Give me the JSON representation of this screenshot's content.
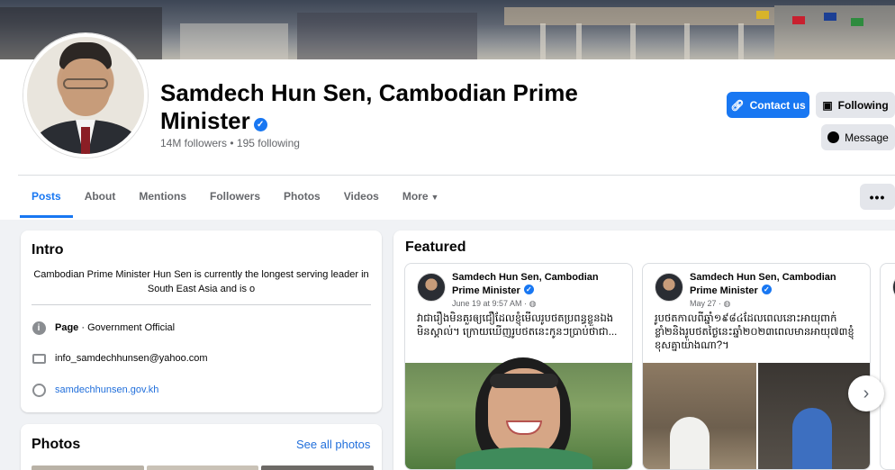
{
  "profile": {
    "name": "Samdech Hun Sen, Cambodian Prime Minister",
    "counts": "14M followers • 195 following"
  },
  "actions": {
    "contact": "Contact us",
    "following": "Following",
    "message": "Message",
    "more_dots": "•••"
  },
  "tabs": [
    {
      "label": "Posts",
      "active": true
    },
    {
      "label": "About"
    },
    {
      "label": "Mentions"
    },
    {
      "label": "Followers"
    },
    {
      "label": "Photos"
    },
    {
      "label": "Videos"
    },
    {
      "label": "More"
    }
  ],
  "intro": {
    "title": "Intro",
    "bio": "Cambodian Prime Minister Hun Sen is currently the longest serving leader in South East Asia and is o",
    "category_label": "Page",
    "category_value": " · Government Official",
    "email": "info_samdechhunsen@yahoo.com",
    "website": "samdechhunsen.gov.kh"
  },
  "photos": {
    "title": "Photos",
    "see_all": "See all photos"
  },
  "featured": {
    "title": "Featured",
    "posts": [
      {
        "author": "Samdech Hun Sen, Cambodian Prime Minister",
        "date": "June 19 at 9:57 AM · ",
        "text": "វាជារឿងមិនគួរឲ្យជឿដែលខ្ញុំមើលរូបថតប្រពន្ធខ្លួនឯងមិនស្គាល់។ ក្រោយឃើញរូបថតនេះកូនៗប្រាប់ថាជា..."
      },
      {
        "author": "Samdech Hun Sen, Cambodian Prime Minister",
        "date": "May 27 · ",
        "text": "រូបថតកាលពីឆ្នាំ១៩៨៤ដែលពេលនោះអាយុពាក់ខ្លាំ២និងរូបថតថ្ងៃនេះឆ្នាំ២០២៣ពេលមានអាយុ៧៣ខ្ញុំខុសគ្នាយ៉ាងណា?។"
      }
    ]
  },
  "colors": {
    "accent": "#1877f2",
    "background": "#f0f2f5",
    "secondary_text": "#65676b"
  }
}
